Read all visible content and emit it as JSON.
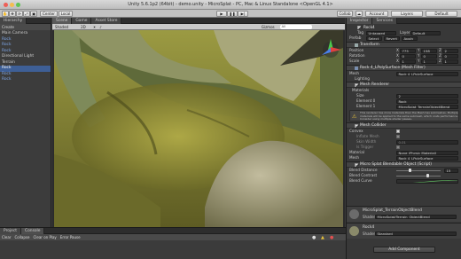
{
  "window": {
    "title": "Unity 5.6.1p2 (64bit) - demo.unity - MicroSplat - PC, Mac & Linux Standalone <OpenGL 4.1>"
  },
  "toolbar": {
    "center": "Center",
    "local": "Local",
    "collab": "Collab",
    "account": "Account",
    "layers": "Layers",
    "layout": "Default"
  },
  "hierarchy": {
    "tab": "Hierarchy",
    "create": "Create",
    "items": [
      "Main Camera",
      "Rock",
      "Rock",
      "Rock",
      "Directional Light",
      "Terrain",
      "Rock",
      "Rock",
      "Rock"
    ]
  },
  "scene": {
    "tabs": [
      "Scene",
      "Game",
      "Asset Store"
    ],
    "shading": "Shaded",
    "mode": "2D",
    "gizmos": "Gizmos",
    "search": "All"
  },
  "inspector": {
    "tabs": [
      "Inspector",
      "Services"
    ],
    "object": {
      "name": "Rock4",
      "tag_label": "Tag",
      "tag": "Untagged",
      "layer_label": "Layer",
      "layer": "Default",
      "prefab": "Prefab",
      "select": "Select",
      "revert": "Revert",
      "apply": "Apply"
    },
    "transform": {
      "header": "Transform",
      "rows": [
        {
          "label": "Position",
          "x": "775",
          "y": "158",
          "z": "2"
        },
        {
          "label": "Rotation",
          "x": "0",
          "y": "0",
          "z": "0"
        },
        {
          "label": "Scale",
          "x": "1",
          "y": "1",
          "z": "1"
        }
      ]
    },
    "mesh_filter": {
      "header": "Rock 4_LPolySurface (Mesh Filter)",
      "mesh_label": "Mesh",
      "mesh": "Rock 4_LPolySurface"
    },
    "lighting": {
      "header": "Lighting"
    },
    "mesh_renderer": {
      "header": "Mesh Renderer",
      "materials": "Materials",
      "size_label": "Size",
      "size": "2",
      "el0_label": "Element 0",
      "el0": "Rock",
      "el1_label": "Element 1",
      "el1": "MicroSplat_TerrainObjectBlend",
      "warning": "This renderer has more materials than the Mesh has submeshes. Multiple materials will be applied to the same submesh, which costs performance. Consider using multiple shader passes."
    },
    "mesh_collider": {
      "header": "Mesh Collider",
      "convex": "Convex",
      "inflate_mesh": "Inflate Mesh",
      "skin_width": "Skin Width",
      "skin_value": "0.01",
      "is_trigger": "Is Trigger",
      "material_label": "Material",
      "material": "None (Physic Material)",
      "mesh_label": "Mesh",
      "mesh": "Rock 4_LPolySurface"
    },
    "blendable": {
      "header": "Micro Splat Blendable Object (Script)",
      "blend_distance": "Blend Distance",
      "blend_distance_value": "15",
      "blend_contrast": "Blend Contrast",
      "blend_curve": "Blend Curve"
    },
    "material_blend": {
      "name": "MicroSplat_TerrainObjectBlend",
      "shader_label": "Shader",
      "shader": "MicroSplat/Terrain_ObjectBlend"
    },
    "material_rock": {
      "name": "Rock4",
      "shader_label": "Shader",
      "shader": "Standard"
    },
    "add_component": "Add Component"
  },
  "console": {
    "tabs": [
      "Project",
      "Console"
    ],
    "buttons": [
      "Clear",
      "Collapse",
      "Clear on Play",
      "Error Pause"
    ]
  },
  "colors": {
    "selection": "#3e5f96",
    "moss": "#8a8a2c",
    "panel": "#383838"
  }
}
